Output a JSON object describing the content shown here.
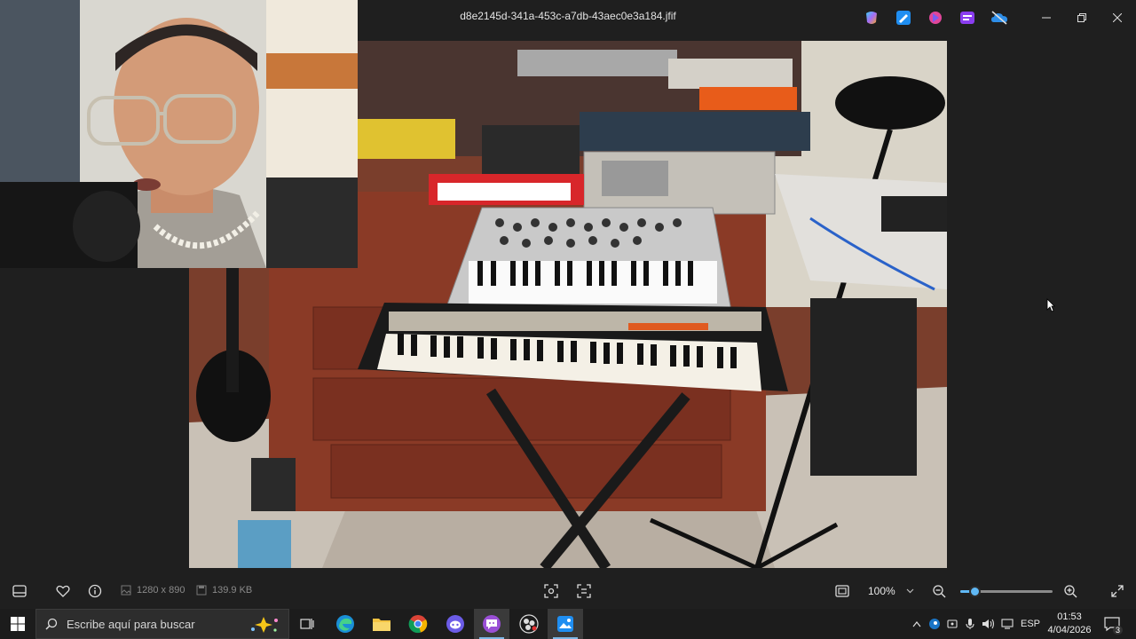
{
  "window": {
    "filename": "d8e2145d-341a-453c-a7db-43aec0e3a184.jfif",
    "controls": [
      "minimize",
      "restore",
      "close"
    ]
  },
  "title_apps": [
    "copilot-icon",
    "photos-edit-icon",
    "designer-icon",
    "clipchamp-icon",
    "onedrive-icon"
  ],
  "toolbar": {
    "dimensions": "1280 x 890",
    "file_size": "139.9 KB",
    "zoom_value": "100%",
    "zoom_level": 0.15
  },
  "taskbar": {
    "search_placeholder": "Escribe aquí para buscar",
    "language": "ESP",
    "time": "01:53",
    "date": "4/04/2026",
    "notification_count": "3"
  },
  "colors": {
    "accent": "#5fb8f5",
    "background": "#1f1f1f",
    "taskbar": "#1c1c1c"
  }
}
